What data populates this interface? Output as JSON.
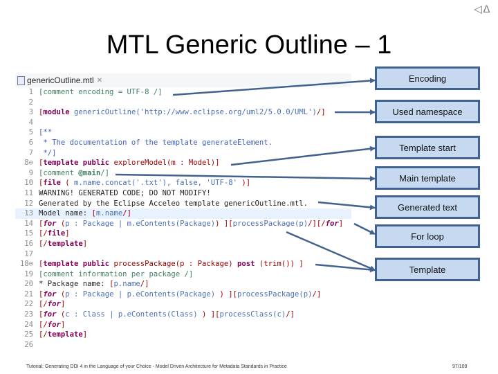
{
  "nav": {
    "prev_icon": "◁",
    "up_icon": "∆"
  },
  "slide": {
    "title": "MTL Generic Outline – 1"
  },
  "editor": {
    "tab_label": "genericOutline.mtl",
    "tab_close": "✕",
    "lines": [
      {
        "n": "1",
        "segs": [
          [
            "cm",
            "[comment encoding = UTF-8 /]"
          ]
        ]
      },
      {
        "n": "2",
        "segs": []
      },
      {
        "n": "3",
        "segs": [
          [
            "br",
            "["
          ],
          [
            "kw",
            "module"
          ],
          [
            "id",
            " genericOutline('http://www.eclipse.org/uml2/5.0.0/UML')"
          ],
          [
            "br",
            "/]"
          ]
        ]
      },
      {
        "n": "4",
        "segs": []
      },
      {
        "n": "5",
        "segs": [
          [
            "doc",
            "[**"
          ]
        ]
      },
      {
        "n": "6",
        "segs": [
          [
            "doc",
            " * The documentation of the template generateElement."
          ]
        ]
      },
      {
        "n": "7",
        "segs": [
          [
            "doc",
            " */]"
          ]
        ]
      },
      {
        "n": "8⊖",
        "segs": [
          [
            "br",
            "["
          ],
          [
            "kw",
            "template public"
          ],
          [
            "br",
            " exploreModel(m : Model)]"
          ]
        ]
      },
      {
        "n": "9",
        "segs": [
          [
            "cm",
            "[comment "
          ],
          [
            "ann",
            "@main"
          ],
          [
            "cm",
            "/]"
          ]
        ]
      },
      {
        "n": "10",
        "segs": [
          [
            "br",
            "["
          ],
          [
            "kw",
            "file"
          ],
          [
            "br",
            " ( "
          ],
          [
            "id",
            "m.name.concat('.txt'), false, 'UTF-8'"
          ],
          [
            "br",
            " )]"
          ]
        ]
      },
      {
        "n": "11",
        "segs": [
          [
            "tx",
            "WARNING! GENERATED CODE; DO NOT MODIFY!"
          ]
        ]
      },
      {
        "n": "12",
        "segs": [
          [
            "tx",
            "Generated by the Eclipse Acceleo template genericOutline.mtl."
          ]
        ]
      },
      {
        "n": "13",
        "hl": true,
        "segs": [
          [
            "tx",
            "Model name: "
          ],
          [
            "br",
            "["
          ],
          [
            "id",
            "m.name"
          ],
          [
            "br",
            "/]"
          ]
        ]
      },
      {
        "n": "14",
        "segs": [
          [
            "br",
            "["
          ],
          [
            "kw it",
            "for"
          ],
          [
            "br",
            " ("
          ],
          [
            "id",
            "p : Package | m.eContents(Package)"
          ],
          [
            "br",
            ") ]["
          ],
          [
            "id",
            "processPackage(p)"
          ],
          [
            "br",
            "/][/"
          ],
          [
            "kw it",
            "for"
          ],
          [
            "br",
            "]"
          ]
        ]
      },
      {
        "n": "15",
        "segs": [
          [
            "br",
            "[/"
          ],
          [
            "kw",
            "file"
          ],
          [
            "br",
            "]"
          ]
        ]
      },
      {
        "n": "16",
        "segs": [
          [
            "br",
            "[/"
          ],
          [
            "kw",
            "template"
          ],
          [
            "br",
            "]"
          ]
        ]
      },
      {
        "n": "17",
        "segs": []
      },
      {
        "n": "18⊖",
        "segs": [
          [
            "br",
            "["
          ],
          [
            "kw",
            "template public"
          ],
          [
            "br",
            " processPackage(p : Package) "
          ],
          [
            "kw",
            "post"
          ],
          [
            "br",
            " (trim()) ]"
          ]
        ]
      },
      {
        "n": "19",
        "segs": [
          [
            "cm",
            "[comment information per package /]"
          ]
        ]
      },
      {
        "n": "20",
        "segs": [
          [
            "tx",
            "* Package name: "
          ],
          [
            "br",
            "["
          ],
          [
            "id",
            "p.name"
          ],
          [
            "br",
            "/]"
          ]
        ]
      },
      {
        "n": "21",
        "segs": [
          [
            "br",
            "["
          ],
          [
            "kw it",
            "for"
          ],
          [
            "br",
            " ("
          ],
          [
            "id",
            "p : Package | p.eContents(Package) "
          ],
          [
            "br",
            ") ]["
          ],
          [
            "id",
            "processPackage(p)"
          ],
          [
            "br",
            "/]"
          ]
        ]
      },
      {
        "n": "22",
        "segs": [
          [
            "br",
            "[/"
          ],
          [
            "kw it",
            "for"
          ],
          [
            "br",
            "]"
          ]
        ]
      },
      {
        "n": "23",
        "segs": [
          [
            "br",
            "["
          ],
          [
            "kw it",
            "for"
          ],
          [
            "br",
            " ("
          ],
          [
            "id",
            "c : Class | p.eContents(Class) "
          ],
          [
            "br",
            ") ]["
          ],
          [
            "id",
            "processClass(c)"
          ],
          [
            "br",
            "/]"
          ]
        ]
      },
      {
        "n": "24",
        "segs": [
          [
            "br",
            "[/"
          ],
          [
            "kw it",
            "for"
          ],
          [
            "br",
            "]"
          ]
        ]
      },
      {
        "n": "25",
        "segs": [
          [
            "br",
            "[/"
          ],
          [
            "kw",
            "template"
          ],
          [
            "br",
            "]"
          ]
        ]
      },
      {
        "n": "26",
        "segs": []
      }
    ]
  },
  "callouts": [
    {
      "label": "Encoding"
    },
    {
      "label": "Used namespace"
    },
    {
      "label": "Template start"
    },
    {
      "label": "Main template"
    },
    {
      "label": "Generated text"
    },
    {
      "label": "For loop"
    },
    {
      "label": "Template"
    }
  ],
  "colors": {
    "callout_fill": "#c6d9f1",
    "callout_border": "#41618e",
    "arrow": "#41618e"
  },
  "footer": {
    "text": "Tutorial: Generating DDI 4 in the Language of your Choice - Model Driven Architecture for Metadata Standards in Practice",
    "page": "97/109"
  }
}
